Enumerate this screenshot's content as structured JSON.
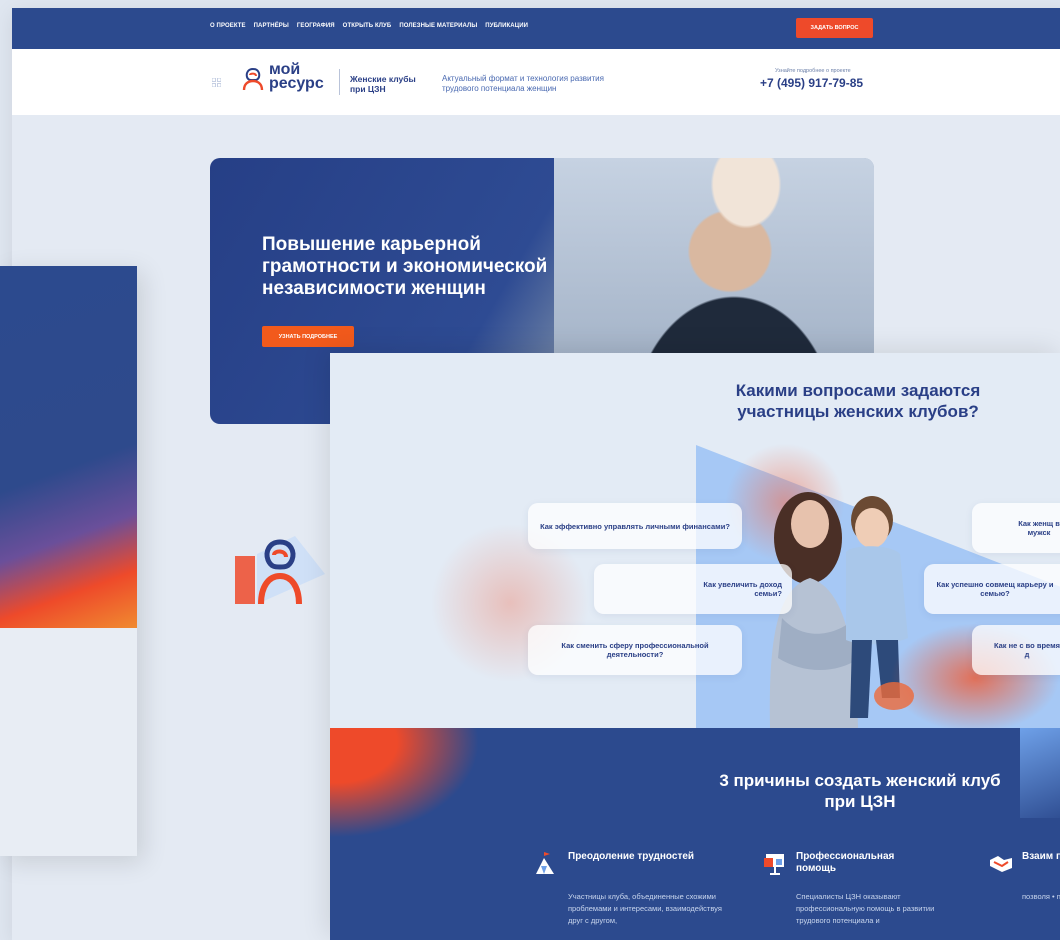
{
  "nav": {
    "items": [
      "О ПРОЕКТЕ",
      "ПАРТНЁРЫ",
      "ГЕОГРАФИЯ",
      "ОТКРЫТЬ КЛУБ",
      "ПОЛЕЗНЫЕ МАТЕРИАЛЫ",
      "ПУБЛИКАЦИИ"
    ],
    "ask_button": "ЗАДАТЬ ВОПРОС"
  },
  "header": {
    "logo_line1": "мой",
    "logo_line2": "ресурс",
    "clubs_line1": "Женские клубы",
    "clubs_line2": "при ЦЗН",
    "tagline_line1": "Актуальный формат и технология развития",
    "tagline_line2": "трудового потенциала женщин",
    "phone_sub": "Узнайте подробнее о проекте",
    "phone": "+7 (495) 917-79-85"
  },
  "hero": {
    "title": "Повышение карьерной грамотности и экономической независимости женщин",
    "button": "УЗНАТЬ ПОДРОБНЕЕ"
  },
  "questions": {
    "title": "Какими вопросами задаются участницы женских клубов?",
    "items": [
      "Как эффективно управлять личными финансами?",
      "Как увеличить доход семьи?",
      "Как сменить сферу профессиональной деятельности?",
      "Как женщ в мужск",
      "Как успешно совмещ карьеру и семью?",
      "Как не с во время д"
    ]
  },
  "reasons": {
    "title": "3 причины создать женский клуб при ЦЗН",
    "items": [
      {
        "title": "Преодоление трудностей",
        "text": "Участницы клуба, объединенные схожими проблемами и интересами, взаимодействуя друг с другом,"
      },
      {
        "title": "Профессиональная помощь",
        "text": "Специалисты ЦЗН оказывают профессиональную помощь в развитии трудового потенциала и"
      },
      {
        "title": "Взаим подде",
        "text": "позволя • при"
      }
    ]
  },
  "colors": {
    "brand_blue": "#2c4a8e",
    "accent_orange": "#ee4a2a",
    "dark_text": "#2a3f86"
  }
}
